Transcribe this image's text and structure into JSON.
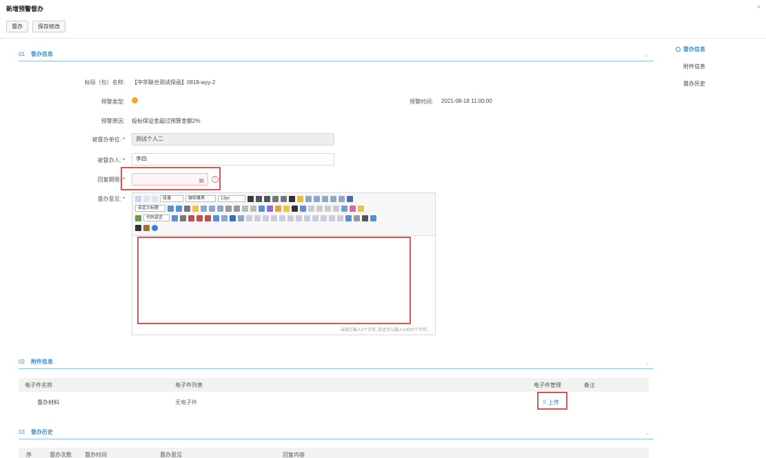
{
  "window": {
    "title": "新增预警督办",
    "close": "×"
  },
  "toolbar": {
    "supervise_label": "督办",
    "save_label": "保存修改"
  },
  "sections": {
    "info": {
      "num": "01",
      "title": "督办信息"
    },
    "attach": {
      "num": "02",
      "title": "附件信息"
    },
    "history": {
      "num": "03",
      "title": "督办历史"
    }
  },
  "form": {
    "lot_label": "标段（包）名称:",
    "lot_value": "【中华联合测试保函】0818-wyy-2",
    "type_label": "预警类型:",
    "type_color": "#f5a623",
    "time_label": "预警时间:",
    "time_value": "2021-08-18 11:00:00",
    "reason_label": "预警原因:",
    "reason_value": "投标保证金超过预算金额2%",
    "unit_label": "被督办单位:",
    "unit_value": "测试个人二",
    "person_label": "被督办人:",
    "person_value": "李四",
    "deadline_label": "回复期限:",
    "deadline_value": "",
    "opinion_label": "督办意见:",
    "required_mark": "*"
  },
  "editor": {
    "paragraph_select": "段落",
    "font_select": "微软雅黑",
    "size_select": "13px",
    "title_select": "自定义标题",
    "code_select": "代码语言",
    "status": "当前已输入0个字符, 您还可以输入10000个字符。"
  },
  "sidenav": [
    "督办信息",
    "附件信息",
    "督办历史"
  ],
  "attachments": {
    "headers": [
      "电子件名称",
      "电子件列表",
      "电子件管理",
      "备注"
    ],
    "rows": [
      {
        "name": "督办材料",
        "list": "无电子件",
        "action": "上传",
        "note": ""
      }
    ]
  },
  "history": {
    "headers": [
      "序",
      "督办次数",
      "督办时间",
      "督办意见",
      "回复内容"
    ]
  },
  "colors": {
    "accent": "#3b8fd0",
    "error": "#d9534f"
  }
}
